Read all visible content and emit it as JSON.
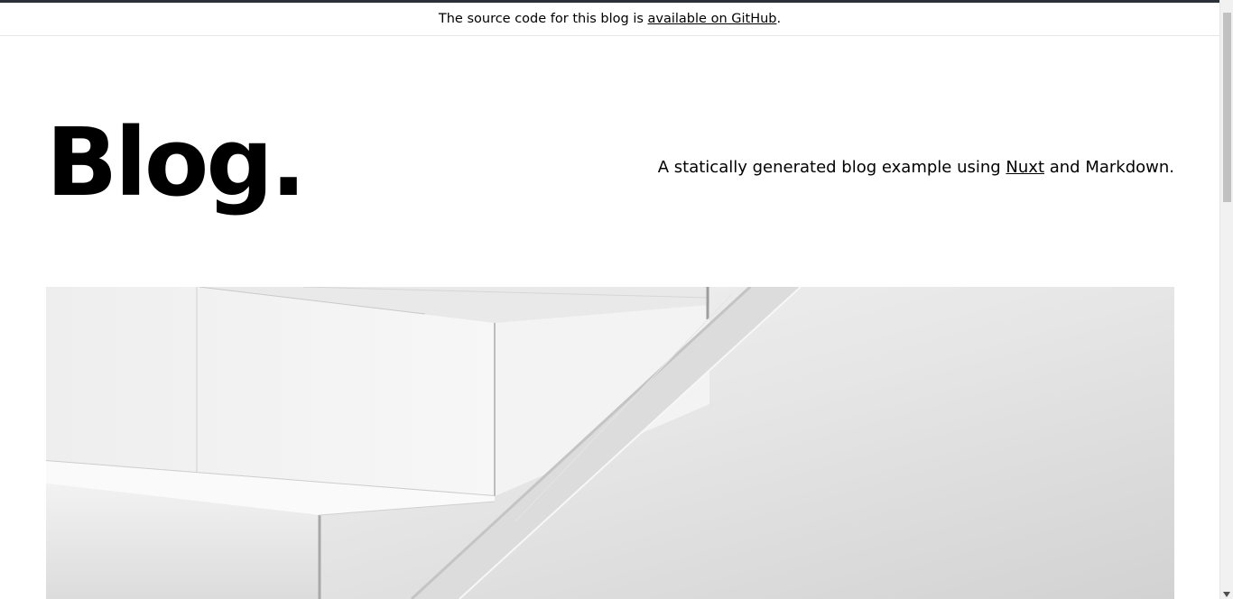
{
  "banner": {
    "text_before": "The source code for this blog is ",
    "link_text": "available on GitHub",
    "text_after": "."
  },
  "header": {
    "title": "Blog.",
    "tagline_before": "A statically generated blog example using ",
    "tagline_link": "Nuxt",
    "tagline_after": " and Markdown."
  },
  "hero": {
    "icon": "hero-cover-image"
  },
  "colors": {
    "top_strip": "#2b2f38",
    "banner_border": "#e6e6e6",
    "scrollbar_track": "#f1f1f1",
    "scrollbar_thumb": "#c1c1c1"
  }
}
